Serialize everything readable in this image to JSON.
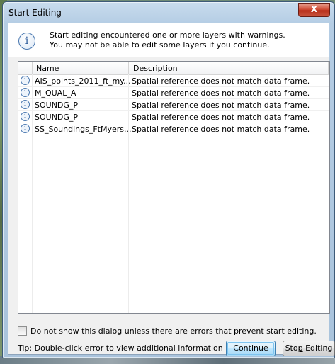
{
  "window": {
    "title": "Start Editing",
    "close_glyph": "X"
  },
  "header": {
    "icon": "info-icon",
    "line1": "Start editing encountered one or more layers with warnings.",
    "line2": "You may not be able to edit some layers if you continue."
  },
  "table": {
    "columns": [
      "Name",
      "Description"
    ],
    "rows": [
      {
        "icon": "info-icon",
        "name": "AIS_points_2011_ft_my...",
        "description": "Spatial reference does not match data frame."
      },
      {
        "icon": "info-icon",
        "name": "M_QUAL_A",
        "description": "Spatial reference does not match data frame."
      },
      {
        "icon": "info-icon",
        "name": "SOUNDG_P",
        "description": "Spatial reference does not match data frame."
      },
      {
        "icon": "info-icon",
        "name": "SOUNDG_P",
        "description": "Spatial reference does not match data frame."
      },
      {
        "icon": "info-icon",
        "name": "SS_Soundings_FtMyers...",
        "description": "Spatial reference does not match data frame."
      }
    ]
  },
  "footer": {
    "checkbox_label": "Do not show this dialog unless there are errors that prevent start editing.",
    "checkbox_checked": false,
    "tip": "Tip: Double-click error to view additional information",
    "continue_label": "Continue",
    "stop_label_pre": "Sto",
    "stop_label_mnemonic": "p",
    "stop_label_post": " Editing"
  },
  "colors": {
    "titlebar": "#b5cde4",
    "close_button": "#c8432e",
    "continue_border": "#3c7fb1"
  }
}
